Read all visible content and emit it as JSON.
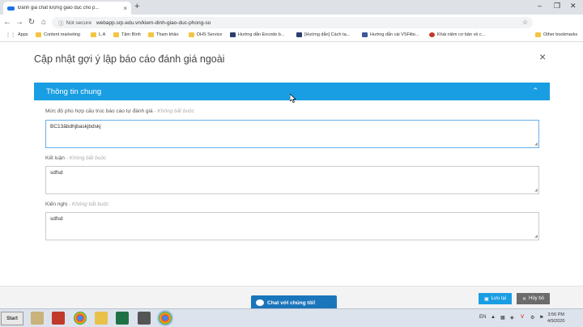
{
  "browser": {
    "tab_title": "Đánh giá chất lượng giáo dục cho p...",
    "tab_close": "×",
    "new_tab": "+",
    "security_label": "Not secure",
    "url": "webapp.srp.edu.vn/kiem-dinh-giao-duc-phong-so"
  },
  "bookmarks": {
    "apps": "Apps",
    "items": [
      "Content marketing",
      "L.A",
      "Tâm Bình",
      "Tham khảo",
      "DHS Service",
      "Hướng dẫn Encode b...",
      "[Hướng dẫn] Cách tạ...",
      "Hướng dẫn cài VSFilte...",
      "Khái niệm cơ bản về c..."
    ],
    "other": "Other bookmarks"
  },
  "modal": {
    "title": "Cập nhật gợi ý lập báo cáo đánh giá ngoài",
    "close": "×",
    "section_title": "Thông tin chung",
    "section_toggle": "⌃",
    "fields": [
      {
        "label": "Mức độ phù hợp cấu trúc báo cáo tự đánh giá",
        "optional": "Không bắt buộc",
        "value": "BC13ăbdhjbaskjbdskj"
      },
      {
        "label": "Kết luận",
        "optional": "Không bắt buộc",
        "value": "sdfsd"
      },
      {
        "label": "Kiến nghị",
        "optional": "Không bắt buộc",
        "value": "sdfsd"
      }
    ]
  },
  "footer": {
    "chat_label": "Chat với chúng tôi!",
    "save_label": "Lưu lại",
    "cancel_label": "Hủy bỏ"
  },
  "taskbar": {
    "start_label": "Start",
    "lang": "EN",
    "time": "3:56 PM",
    "date": "4/9/2020"
  }
}
